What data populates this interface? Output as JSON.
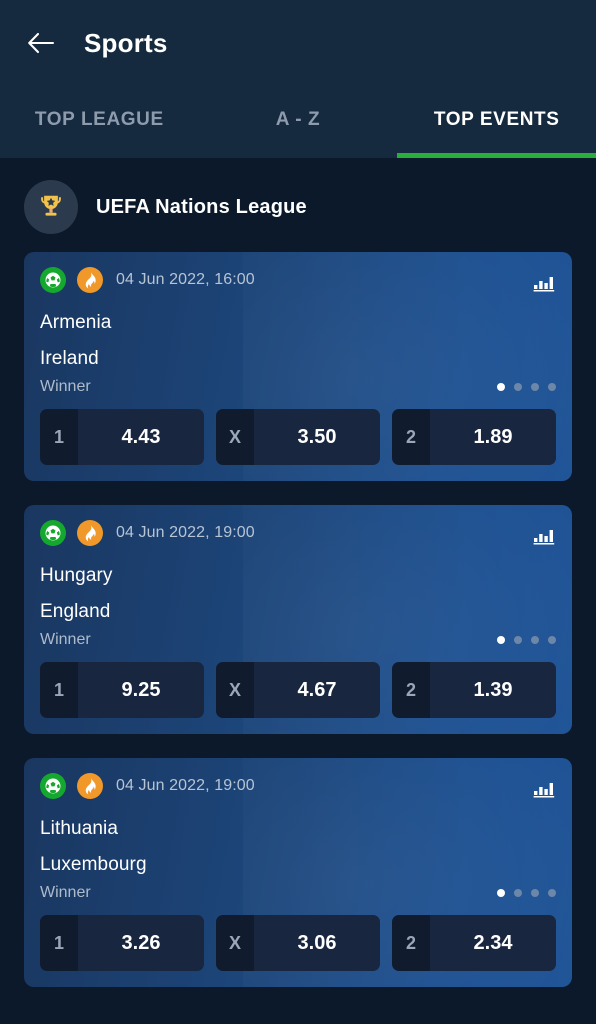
{
  "header": {
    "back_icon": "arrow-left-icon",
    "title": "Sports"
  },
  "tabs": [
    {
      "label": "TOP LEAGUE",
      "active": false
    },
    {
      "label": "A - Z",
      "active": false
    },
    {
      "label": "TOP EVENTS",
      "active": true
    }
  ],
  "accent_color": "#29ad3c",
  "league": {
    "icon": "trophy-icon",
    "name": "UEFA Nations League"
  },
  "matches": [
    {
      "sport_icon": "soccer-ball-icon",
      "hot_icon": "flame-icon",
      "time": "04 Jun 2022, 16:00",
      "stats_icon": "bar-chart-icon",
      "home_team": "Armenia",
      "away_team": "Ireland",
      "market": "Winner",
      "page_count": 4,
      "page_active": 0,
      "odds": [
        {
          "key": "1",
          "value": "4.43"
        },
        {
          "key": "X",
          "value": "3.50"
        },
        {
          "key": "2",
          "value": "1.89"
        }
      ]
    },
    {
      "sport_icon": "soccer-ball-icon",
      "hot_icon": "flame-icon",
      "time": "04 Jun 2022, 19:00",
      "stats_icon": "bar-chart-icon",
      "home_team": "Hungary",
      "away_team": "England",
      "market": "Winner",
      "page_count": 4,
      "page_active": 0,
      "odds": [
        {
          "key": "1",
          "value": "9.25"
        },
        {
          "key": "X",
          "value": "4.67"
        },
        {
          "key": "2",
          "value": "1.39"
        }
      ]
    },
    {
      "sport_icon": "soccer-ball-icon",
      "hot_icon": "flame-icon",
      "time": "04 Jun 2022, 19:00",
      "stats_icon": "bar-chart-icon",
      "home_team": "Lithuania",
      "away_team": "Luxembourg",
      "market": "Winner",
      "page_count": 4,
      "page_active": 0,
      "odds": [
        {
          "key": "1",
          "value": "3.26"
        },
        {
          "key": "X",
          "value": "3.06"
        },
        {
          "key": "2",
          "value": "2.34"
        }
      ]
    }
  ]
}
